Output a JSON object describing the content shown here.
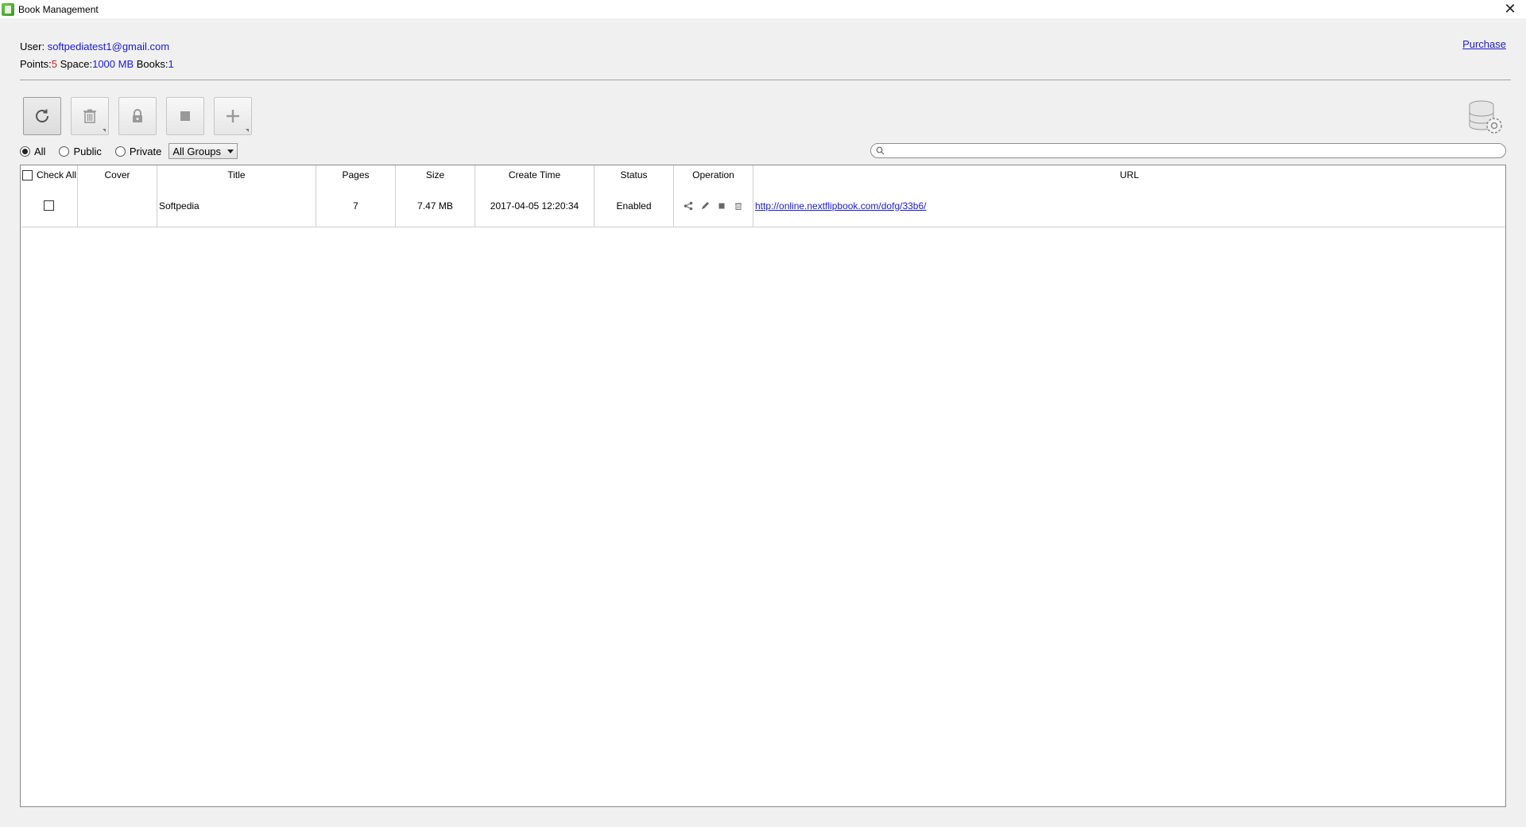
{
  "window": {
    "title": "Book Management",
    "close_glyph": "✕"
  },
  "user": {
    "user_label": "User:",
    "email": "softpediatest1@gmail.com",
    "points_label": "Points:",
    "points": "5",
    "space_label": "Space:",
    "space": "1000 MB",
    "books_label": "Books:",
    "books": "1"
  },
  "purchase_label": "Purchase",
  "toolbar": {
    "buttons": [
      "refresh-icon",
      "trash-icon",
      "lock-icon",
      "stop-icon",
      "plus-icon"
    ]
  },
  "filters": {
    "all_label": "All",
    "public_label": "Public",
    "private_label": "Private",
    "selected": "All",
    "group_value": "All Groups"
  },
  "search": {
    "placeholder": ""
  },
  "table": {
    "headers": {
      "check_all": "Check All",
      "cover": "Cover",
      "title": "Title",
      "pages": "Pages",
      "size": "Size",
      "create_time": "Create Time",
      "status": "Status",
      "operation": "Operation",
      "url": "URL"
    },
    "rows": [
      {
        "title": "Softpedia",
        "pages": "7",
        "size": "7.47 MB",
        "create_time": "2017-04-05 12:20:34",
        "status": "Enabled",
        "url": "http://online.nextflipbook.com/dofg/33b6/"
      }
    ]
  }
}
